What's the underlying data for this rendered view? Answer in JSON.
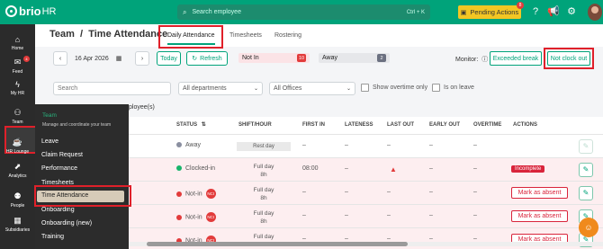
{
  "app": {
    "logo_text": "brio",
    "logo_suffix": "HR"
  },
  "topbar": {
    "search_placeholder": "Search employee",
    "search_shortcut": "Ctrl + K",
    "pending_label": "Pending Actions",
    "pending_count": "8",
    "icons": [
      "help-icon",
      "megaphone-icon",
      "gear-icon"
    ]
  },
  "leftnav": [
    {
      "label": "Home",
      "icon": "⌂"
    },
    {
      "label": "Feed",
      "icon": "✉",
      "badge": "4"
    },
    {
      "label": "My HR",
      "icon": "⚡"
    },
    {
      "label": "Team",
      "icon": "👥"
    },
    {
      "label": "HR Lounge",
      "icon": "☕"
    },
    {
      "label": "Analytics",
      "icon": "📈"
    },
    {
      "label": "People",
      "icon": "⚇"
    },
    {
      "label": "Subsidiaries",
      "icon": "▦"
    }
  ],
  "flyout": {
    "title": "Team",
    "subtitle": "Manage and coordinate your team",
    "items": [
      "Leave",
      "Claim Request",
      "Performance",
      "Timesheets",
      "Time Attendance",
      "Onboarding",
      "Onboarding (new)",
      "Training"
    ],
    "selected": "Time Attendance"
  },
  "header": {
    "title": "Team",
    "subtitle": "Time Attendance",
    "tabs": [
      "Daily Attendance",
      "Timesheets",
      "Rostering"
    ],
    "active_tab": "Daily Attendance"
  },
  "controls": {
    "date": "16 Apr 2026",
    "today": "Today",
    "refresh": "Refresh",
    "not_in_label": "Not In",
    "not_in_count": "10",
    "away_label": "Away",
    "away_count": "2",
    "monitor_label": "Monitor:",
    "exceeded_break": "Exceeded break",
    "not_clock_out": "Not clock out"
  },
  "filters": {
    "search_placeholder": "Search",
    "departments": "All departments",
    "offices": "All Offices",
    "overtime_only": "Show overtime only",
    "is_on_leave": "Is on leave"
  },
  "employees_label": "ployee(s)",
  "table": {
    "headers": [
      "STATUS",
      "SHIFT/HOUR",
      "FIRST IN",
      "LATENESS",
      "LAST OUT",
      "EARLY OUT",
      "OVERTIME",
      "ACTIONS"
    ],
    "rows": [
      {
        "status": "Away",
        "status_color": "#8a8fa0",
        "shift": "Rest day",
        "rest": true,
        "first_in": "–",
        "lateness": "–",
        "last_out": "–",
        "early_out": "–",
        "overtime": "–",
        "action": ""
      },
      {
        "status": "Clocked-in",
        "status_color": "#18b46b",
        "shift": "Full day",
        "hours": "8h",
        "first_in": "08:00",
        "lateness": "–",
        "last_out": "",
        "warn": true,
        "early_out": "–",
        "overtime": "–",
        "action": "Incomplete"
      },
      {
        "status": "Not-in",
        "status_color": "#e23b3b",
        "nci": "NCI",
        "shift": "Full day",
        "hours": "8h",
        "first_in": "–",
        "lateness": "–",
        "last_out": "–",
        "early_out": "–",
        "overtime": "–",
        "action": "Mark as absent"
      },
      {
        "status": "Not-in",
        "status_color": "#e23b3b",
        "nci": "NCI",
        "shift": "Full day",
        "hours": "8h",
        "first_in": "–",
        "lateness": "–",
        "last_out": "–",
        "early_out": "–",
        "overtime": "–",
        "action": "Mark as absent"
      },
      {
        "status": "Not-in",
        "status_color": "#e23b3b",
        "nci": "NCI",
        "shift": "Full day",
        "hours": "8h",
        "first_in": "–",
        "lateness": "–",
        "last_out": "–",
        "early_out": "–",
        "overtime": "–",
        "action": "Mark as absent"
      }
    ]
  }
}
